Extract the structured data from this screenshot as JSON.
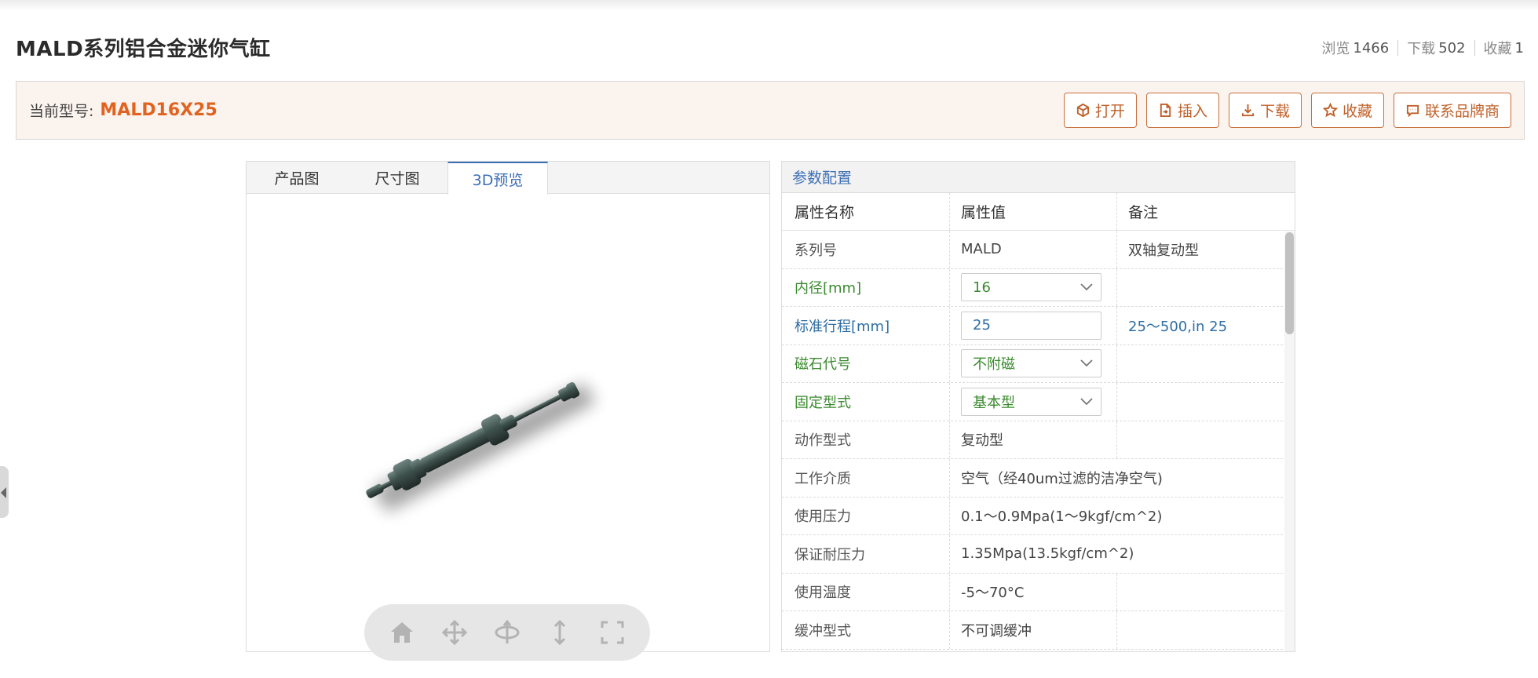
{
  "page": {
    "title": "MALD系列铝合金迷你气缸",
    "stats": [
      {
        "label": "浏览",
        "value": "1466"
      },
      {
        "label": "下载",
        "value": "502"
      },
      {
        "label": "收藏",
        "value": "1"
      }
    ]
  },
  "model_bar": {
    "label": "当前型号:",
    "code": "MALD16X25",
    "buttons": [
      {
        "label": "打开",
        "icon": "cube-icon"
      },
      {
        "label": "插入",
        "icon": "insert-icon"
      },
      {
        "label": "下载",
        "icon": "download-icon"
      },
      {
        "label": "收藏",
        "icon": "star-icon"
      },
      {
        "label": "联系品牌商",
        "icon": "chat-icon"
      }
    ]
  },
  "viewer": {
    "tabs": [
      {
        "label": "产品图",
        "active": false
      },
      {
        "label": "尺寸图",
        "active": false
      },
      {
        "label": "3D预览",
        "active": true
      }
    ],
    "toolbar": [
      "home-icon",
      "pan-icon",
      "rotate-icon",
      "zoom-icon",
      "fullscreen-icon"
    ]
  },
  "params": {
    "heading": "参数配置",
    "columns": [
      "属性名称",
      "属性值",
      "备注"
    ],
    "rows": [
      {
        "name": "系列号",
        "value": "MALD",
        "note": "双轴复动型",
        "kind": "text"
      },
      {
        "name": "内径[mm]",
        "value": "16",
        "note": "",
        "kind": "select"
      },
      {
        "name": "标准行程[mm]",
        "value": "25",
        "note": "25～500,in 25",
        "kind": "input"
      },
      {
        "name": "磁石代号",
        "value": "不附磁",
        "note": "",
        "kind": "select"
      },
      {
        "name": "固定型式",
        "value": "基本型",
        "note": "",
        "kind": "select"
      },
      {
        "name": "动作型式",
        "value": "复动型",
        "note": "",
        "kind": "text"
      },
      {
        "name": "工作介质",
        "value": "空气（经40um过滤的洁净空气)",
        "note": "",
        "kind": "text"
      },
      {
        "name": "使用压力",
        "value": "0.1～0.9Mpa(1～9kgf/cm^2)",
        "note": "",
        "kind": "text"
      },
      {
        "name": "保证耐压力",
        "value": "1.35Mpa(13.5kgf/cm^2)",
        "note": "",
        "kind": "text"
      },
      {
        "name": "使用温度",
        "value": "-5～70°C",
        "note": "",
        "kind": "text"
      },
      {
        "name": "缓冲型式",
        "value": "不可调缓冲",
        "note": "",
        "kind": "text"
      }
    ]
  }
}
